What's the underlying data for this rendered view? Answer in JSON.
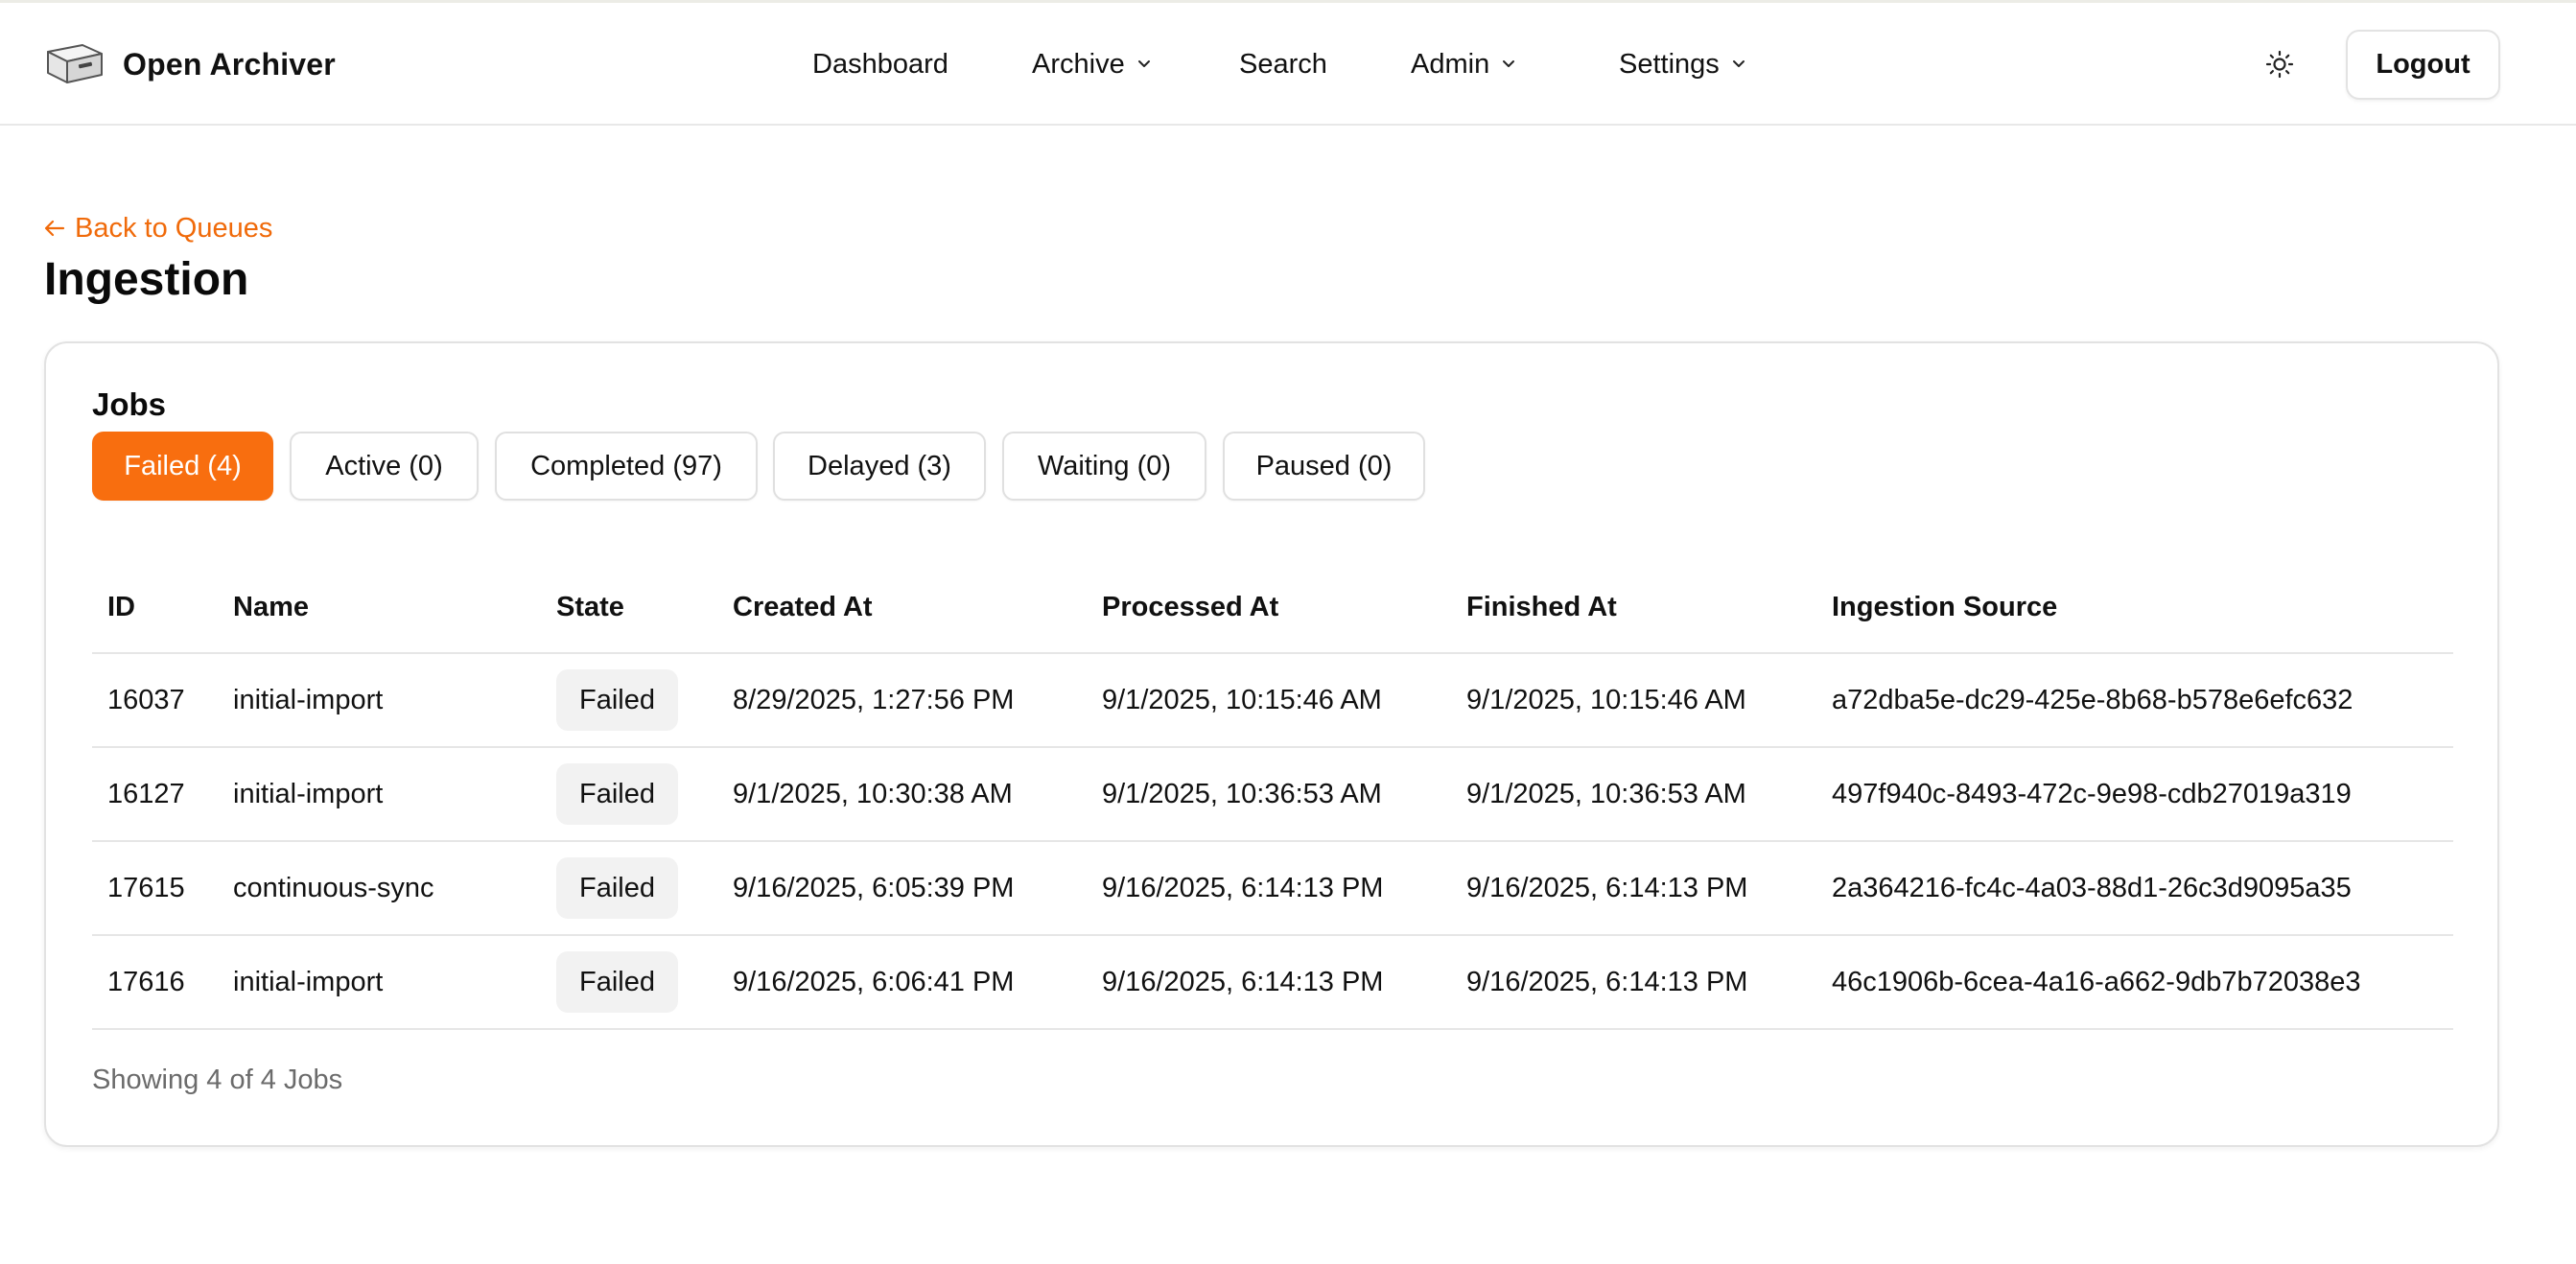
{
  "app": {
    "name": "Open Archiver"
  },
  "nav": {
    "items": [
      {
        "label": "Dashboard"
      },
      {
        "label": "Archive"
      },
      {
        "label": "Search"
      },
      {
        "label": "Admin"
      },
      {
        "label": "Settings"
      }
    ],
    "logout_label": "Logout"
  },
  "page": {
    "back_link": "Back to Queues",
    "title": "Ingestion"
  },
  "jobs": {
    "title": "Jobs",
    "tabs": [
      {
        "label": "Failed (4)",
        "active": true
      },
      {
        "label": "Active (0)",
        "active": false
      },
      {
        "label": "Completed (97)",
        "active": false
      },
      {
        "label": "Delayed (3)",
        "active": false
      },
      {
        "label": "Waiting (0)",
        "active": false
      },
      {
        "label": "Paused (0)",
        "active": false
      }
    ],
    "columns": [
      "ID",
      "Name",
      "State",
      "Created At",
      "Processed At",
      "Finished At",
      "Ingestion Source"
    ],
    "rows": [
      {
        "id": "16037",
        "name": "initial-import",
        "state": "Failed",
        "created": "8/29/2025, 1:27:56 PM",
        "processed": "9/1/2025, 10:15:46 AM",
        "finished": "9/1/2025, 10:15:46 AM",
        "source": "a72dba5e-dc29-425e-8b68-b578e6efc632"
      },
      {
        "id": "16127",
        "name": "initial-import",
        "state": "Failed",
        "created": "9/1/2025, 10:30:38 AM",
        "processed": "9/1/2025, 10:36:53 AM",
        "finished": "9/1/2025, 10:36:53 AM",
        "source": "497f940c-8493-472c-9e98-cdb27019a319"
      },
      {
        "id": "17615",
        "name": "continuous-sync",
        "state": "Failed",
        "created": "9/16/2025, 6:05:39 PM",
        "processed": "9/16/2025, 6:14:13 PM",
        "finished": "9/16/2025, 6:14:13 PM",
        "source": "2a364216-fc4c-4a03-88d1-26c3d9095a35"
      },
      {
        "id": "17616",
        "name": "initial-import",
        "state": "Failed",
        "created": "9/16/2025, 6:06:41 PM",
        "processed": "9/16/2025, 6:14:13 PM",
        "finished": "9/16/2025, 6:14:13 PM",
        "source": "46c1906b-6cea-4a16-a662-9db7b72038e3"
      }
    ],
    "footer": "Showing 4 of 4 Jobs"
  },
  "colors": {
    "accent": "#f86e0f",
    "link": "#f06a0a",
    "badge_bg": "#f2f2f2",
    "border": "#e2e2e2"
  },
  "icons": {
    "logo": "archive-box-icon",
    "theme": "sun-icon",
    "back": "arrow-left-icon",
    "dropdown": "chevron-down-icon"
  }
}
